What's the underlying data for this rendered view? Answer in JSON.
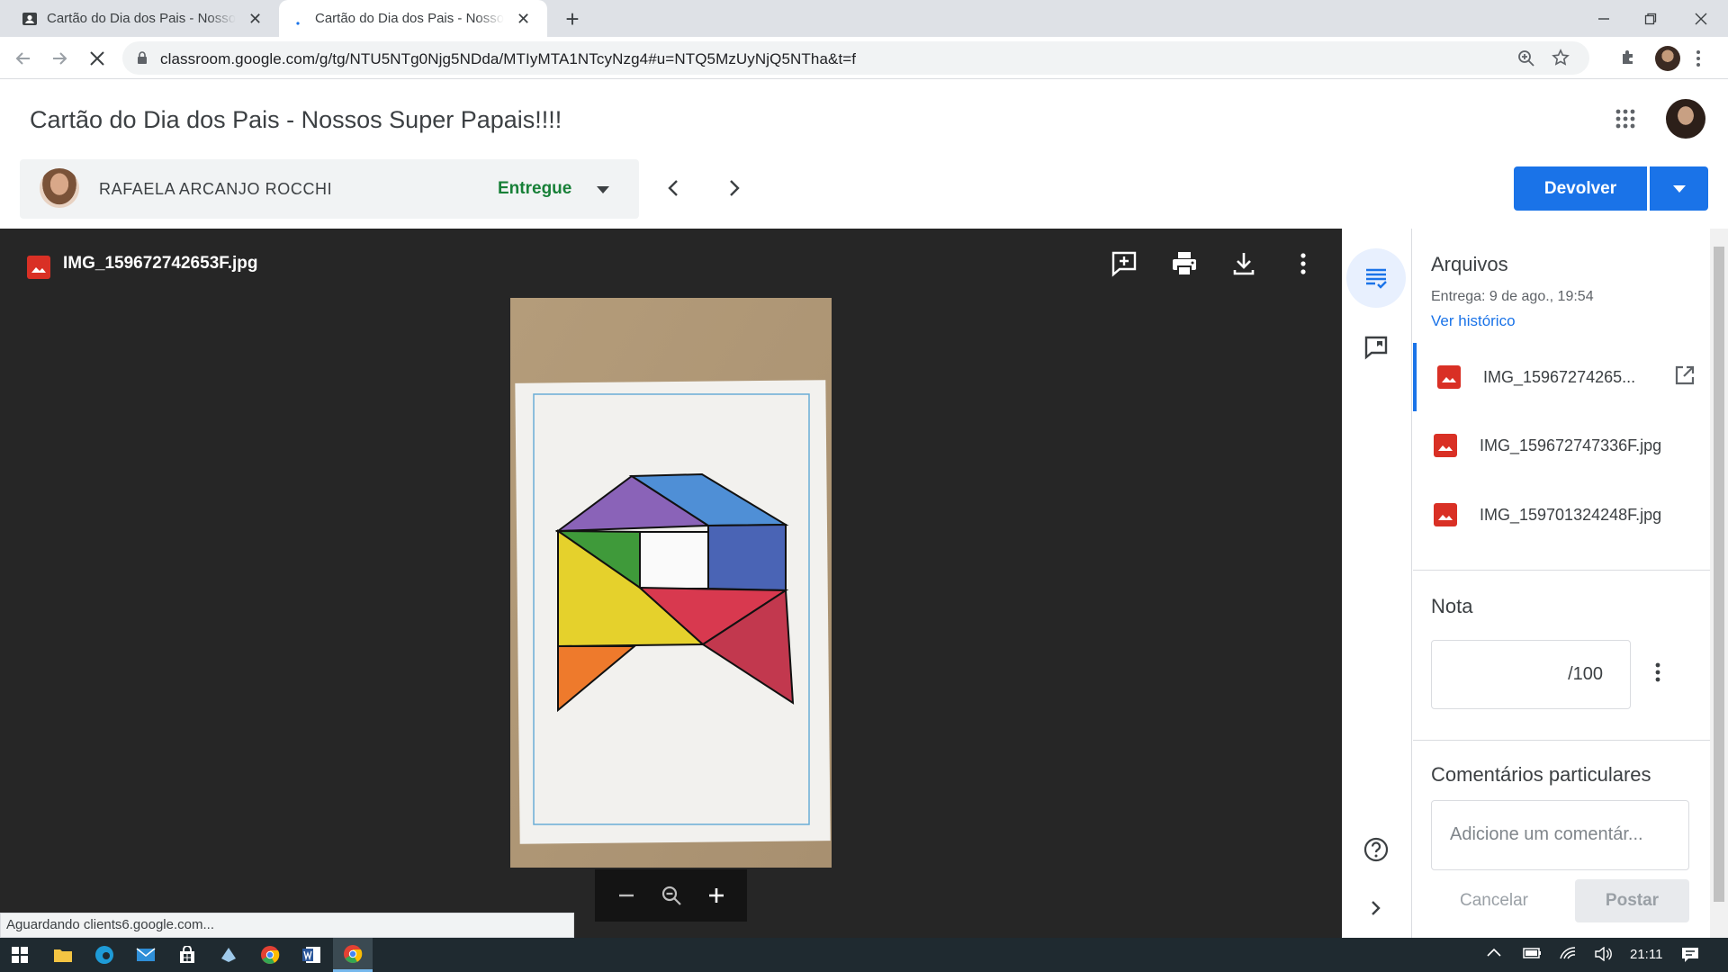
{
  "browser": {
    "tabs": [
      {
        "title": "Cartão do Dia dos Pais - Nossos Super Papais!!!!",
        "active": false
      },
      {
        "title": "Cartão do Dia dos Pais - Nossos Super Papais!!!!",
        "active": true
      }
    ],
    "url": "classroom.google.com/g/tg/NTU5NTg0Njg5NDda/MTIyMTA1NTcyNzg4#u=NTQ5MzUyNjQ5NTha&t=f"
  },
  "header": {
    "title": "Cartão do Dia dos Pais - Nossos Super Papais!!!!"
  },
  "student": {
    "name": "RAFAELA ARCANJO ROCCHI",
    "status": "Entregue",
    "status_color": "#188038"
  },
  "actions": {
    "return_label": "Devolver",
    "accent": "#1a73e8"
  },
  "viewer": {
    "file_name": "IMG_159672742653F.jpg",
    "toolbar_icons": [
      "add-comment-icon",
      "print-icon",
      "download-icon",
      "more-vert-icon"
    ],
    "zoom_icons": [
      "zoom-out-icon",
      "zoom-reset-icon",
      "zoom-in-icon"
    ]
  },
  "status_bar": "Aguardando clients6.google.com...",
  "panel": {
    "files_title": "Arquivos",
    "delivered": "Entrega: 9 de ago., 19:54",
    "history_link": "Ver histórico",
    "files": [
      {
        "name": "IMG_15967274265...",
        "active": true
      },
      {
        "name": "IMG_159672747336F.jpg",
        "active": false
      },
      {
        "name": "IMG_159701324248F.jpg",
        "active": false
      }
    ],
    "grade_title": "Nota",
    "grade_denominator": "/100",
    "comments_title": "Comentários particulares",
    "comment_placeholder": "Adicione um comentár...",
    "cancel_label": "Cancelar",
    "post_label": "Postar"
  },
  "taskbar": {
    "time": "21:11"
  }
}
